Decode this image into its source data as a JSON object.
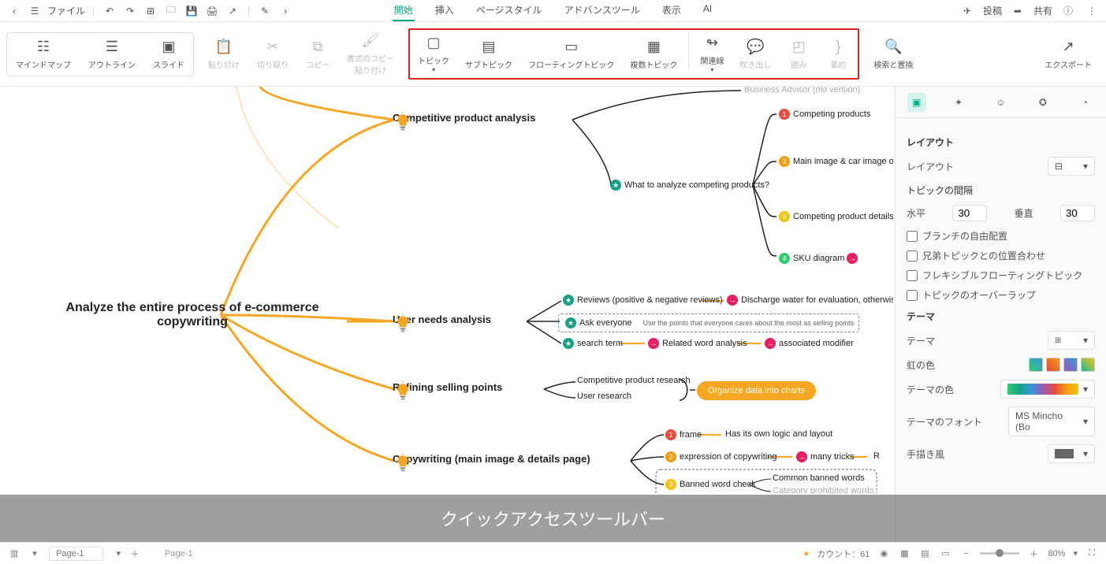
{
  "menu": {
    "file": "ファイル",
    "tabs": [
      "開始",
      "挿入",
      "ページスタイル",
      "アドバンスツール",
      "表示",
      "AI"
    ],
    "post": "投稿",
    "share": "共有"
  },
  "ribbon": {
    "views": [
      "マインドマップ",
      "アウトライン",
      "スライド"
    ],
    "paste": "貼り付け",
    "cut": "切り取り",
    "copy": "コピー",
    "pasteFormat1": "書式のコピー",
    "pasteFormat2": "貼り付け",
    "topic": "トピック",
    "subtopic": "サブトピック",
    "floating": "フローティングトピック",
    "multi": "複数トピック",
    "relation": "関連線",
    "callout": "吹き出し",
    "boundary": "囲み",
    "summary": "要約",
    "findReplace": "検索と置換",
    "export": "エクスポート"
  },
  "map": {
    "center1": "Analyze the entire process of e-commerce",
    "center2": "copywriting",
    "n_compet": "Competitive product analysis",
    "n_user": "User needs analysis",
    "n_refine": "Refining selling points",
    "n_copy": "Copywriting (main image & details page)",
    "bizadv": "Business Advisor (old version)",
    "analyze_q": "What to analyze competing products?",
    "cp1": "Competing products",
    "cp2": "Main image & car image of",
    "cp3": "Competing product details p",
    "cp4": "SKU diagram",
    "reviews": "Reviews (positive & negative reviews)",
    "reviews_r": "Discharge water for evaluation, otherwise",
    "ask": "Ask everyone",
    "ask_r": "Use the points that everyone cares about the most as selling points",
    "search": "search term",
    "search_r1": "Related word analysis",
    "search_r2": "associated modifier",
    "cpr": "Competitive product research",
    "ur": "User research",
    "organize": "Organize data into charts",
    "frame": "frame",
    "frame_r": "Has its own logic and layout",
    "expr": "expression of copywriting",
    "expr_r": "many tricks",
    "expr_r2": "R",
    "banned": "Banned word check",
    "banned_r1": "Common banned words",
    "banned_r2": "Category prohibited words"
  },
  "panel": {
    "layout": "レイアウト",
    "layoutLabel": "レイアウト",
    "spacing": "トピックの間隔",
    "horiz": "水平",
    "horizVal": "30",
    "vert": "垂直",
    "vertVal": "30",
    "chk1": "ブランチの自由配置",
    "chk2": "兄弟トピックとの位置合わせ",
    "chk3": "フレキシブルフローティングトピック",
    "chk4": "トピックのオーバーラップ",
    "theme": "テーマ",
    "themeLabel": "テーマ",
    "rainbow": "虹の色",
    "themeColor": "テーマの色",
    "themeFont": "テーマのフォント",
    "themeFontVal": "MS Mincho (Bo",
    "handdrawn": "手描き風"
  },
  "overlay": "クイックアクセスツールバー",
  "status": {
    "page": "Page-1",
    "page2": "Page-1",
    "count": "カウント：61",
    "zoom": "80%"
  }
}
